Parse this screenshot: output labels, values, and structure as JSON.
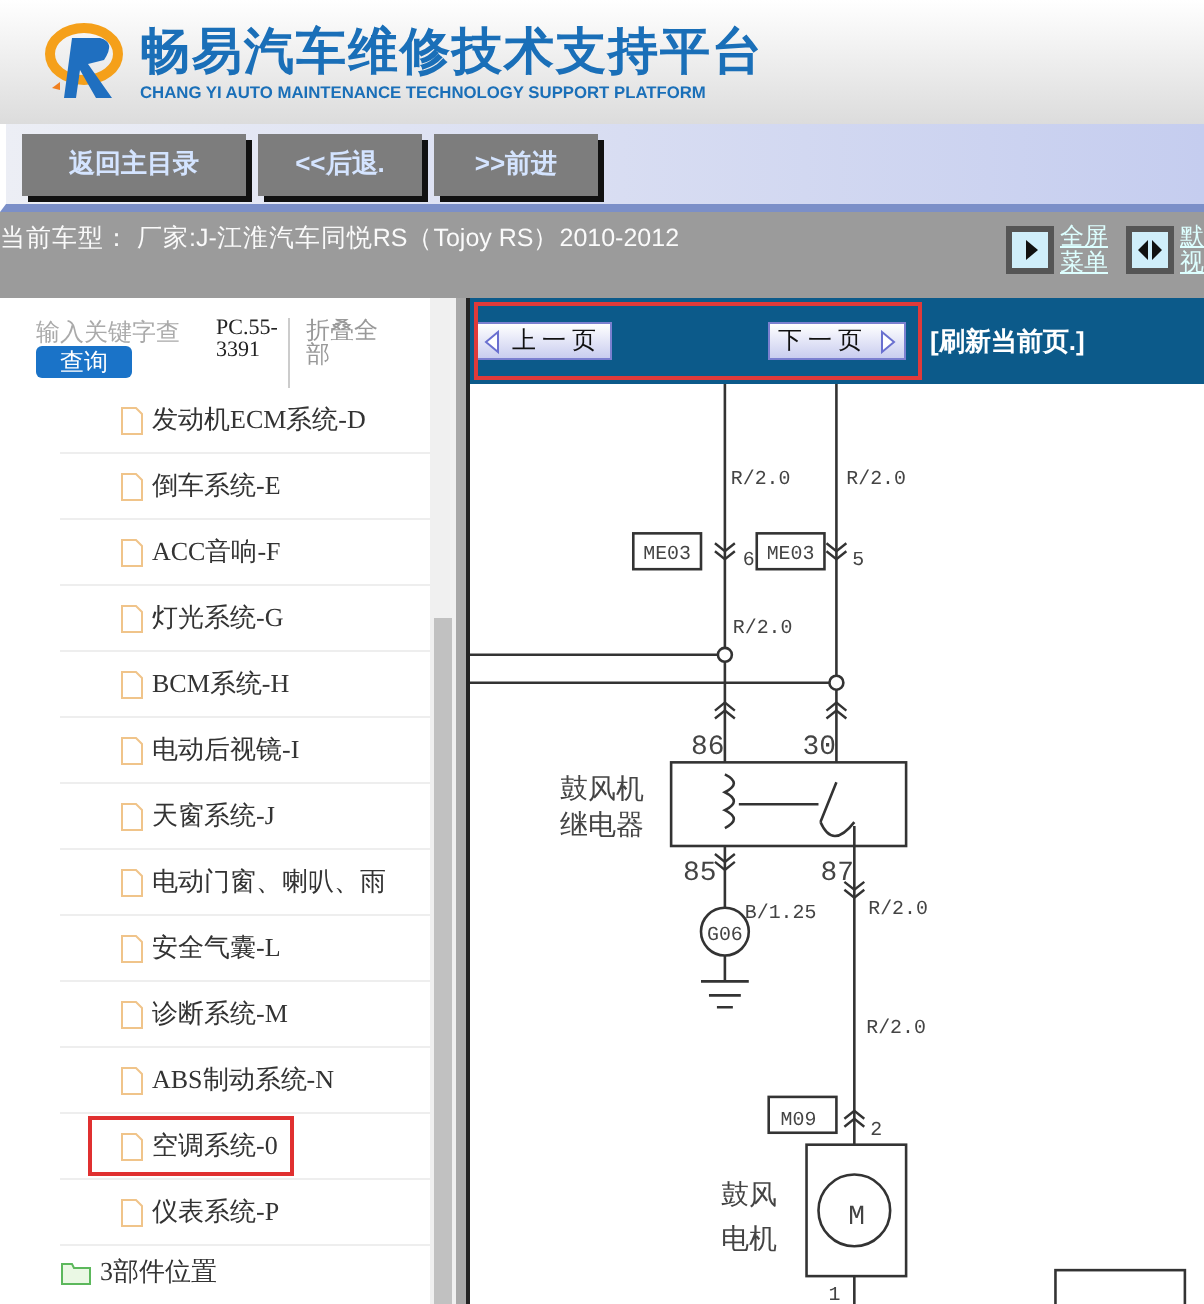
{
  "header": {
    "title": "畅易汽车维修技术支持平台",
    "subtitle": "CHANG YI AUTO MAINTENANCE TECHNOLOGY SUPPORT PLATFORM"
  },
  "nav_buttons": [
    "返回主目录",
    "<<后退.",
    ">>前进"
  ],
  "vehicle_info": "当前车型：  厂家:J-江淮汽车同悦RS（Tojoy RS）2010-2012",
  "view_buttons": [
    {
      "kind": "fullscreen",
      "lines": [
        "全屏",
        "菜单"
      ]
    },
    {
      "kind": "default",
      "lines": [
        "默",
        "视"
      ]
    }
  ],
  "search": {
    "placeholder": "输入关键字查",
    "button": "查询",
    "code": "PC.55-3391",
    "collapse": "折叠全部"
  },
  "tree": [
    {
      "kind": "file",
      "label": "发动机ECM系统-D",
      "selected": false
    },
    {
      "kind": "file",
      "label": "倒车系统-E",
      "selected": false
    },
    {
      "kind": "file",
      "label": "ACC音响-F",
      "selected": false
    },
    {
      "kind": "file",
      "label": "灯光系统-G",
      "selected": false
    },
    {
      "kind": "file",
      "label": "BCM系统-H",
      "selected": false
    },
    {
      "kind": "file",
      "label": "电动后视镜-I",
      "selected": false
    },
    {
      "kind": "file",
      "label": "天窗系统-J",
      "selected": false
    },
    {
      "kind": "file",
      "label": "电动门窗、喇叭、雨",
      "selected": false
    },
    {
      "kind": "file",
      "label": "安全气囊-L",
      "selected": false
    },
    {
      "kind": "file",
      "label": "诊断系统-M",
      "selected": false
    },
    {
      "kind": "file",
      "label": "ABS制动系统-N",
      "selected": false
    },
    {
      "kind": "file",
      "label": "空调系统-0",
      "selected": true
    },
    {
      "kind": "file",
      "label": "仪表系统-P",
      "selected": false
    },
    {
      "kind": "folder",
      "label": "3部件位置",
      "selected": false
    }
  ],
  "pager": {
    "highlighted": true,
    "prev": "上一页",
    "next": "下一页",
    "refresh": "[刷新当前页.]"
  },
  "diagram_labels": [
    "R/2.0",
    "R/2.0",
    "ME03",
    "6",
    "ME03",
    "5",
    "R/2.0",
    "86",
    "30",
    "鼓风机",
    "继电器",
    "85",
    "87",
    "B/1.25",
    "G06",
    "R/2.0",
    "R/2.0",
    "M09",
    "2",
    "鼓风",
    "电机",
    "M",
    "1"
  ]
}
